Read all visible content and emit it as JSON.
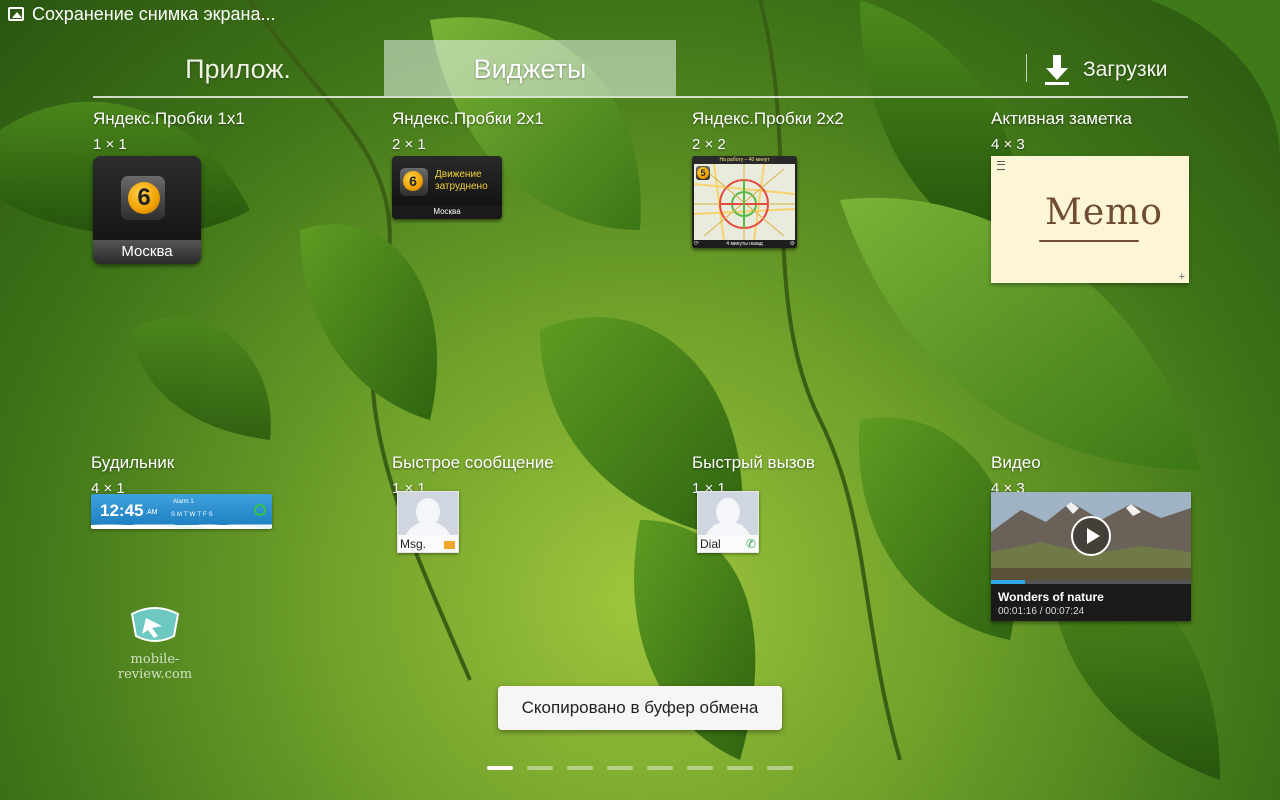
{
  "status_bar": {
    "notification": "Сохранение снимка экрана..."
  },
  "tabs": {
    "apps": "Прилож.",
    "widgets": "Виджеты",
    "downloads": "Загрузки"
  },
  "widgets": [
    {
      "title": "Яндекс.Пробки 1x1",
      "size": "1 × 1",
      "city": "Москва",
      "badge": "6"
    },
    {
      "title": "Яндекс.Пробки 2x1",
      "size": "2 × 1",
      "message": "Движение затруднено",
      "city": "Москва",
      "badge": "6"
    },
    {
      "title": "Яндекс.Пробки 2x2",
      "size": "2 × 2",
      "header": "На работу – 40 минут",
      "footer": "4 минуты назад",
      "badge": "5"
    },
    {
      "title": "Активная заметка",
      "size": "4 × 3",
      "memo_text": "Memo",
      "plus": "+"
    },
    {
      "title": "Будильник",
      "size": "4 × 1",
      "time": "12:45",
      "ampm": "AM",
      "label": "Alarm 1",
      "days": "SMTWTFS"
    },
    {
      "title": "Быстрое сообщение",
      "size": "1 × 1",
      "caption": "Msg."
    },
    {
      "title": "Быстрый вызов",
      "size": "1 × 1",
      "caption": "Dial"
    },
    {
      "title": "Видео",
      "size": "4 × 3",
      "video_title": "Wonders of nature",
      "video_time": "00:01:16 / 00:07:24",
      "progress": 0.17
    }
  ],
  "watermark": {
    "text": "mobile-review.com"
  },
  "toast": {
    "text": "Скопировано в буфер обмена"
  },
  "pager": {
    "pages": 8,
    "active": 0
  },
  "colors": {
    "accent": "#2fa7e3",
    "tab_active_bg": "#ebf5f0",
    "toast_bg": "#f6f6f6"
  }
}
